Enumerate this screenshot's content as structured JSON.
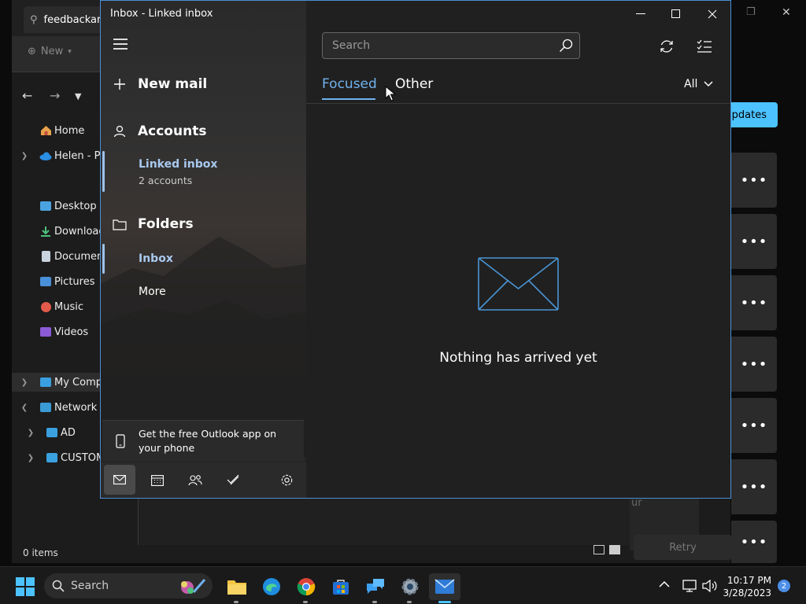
{
  "explorer": {
    "tab_title": "feedbackarc",
    "new_label": "New",
    "sidebar": [
      {
        "label": "Home"
      },
      {
        "label": "Helen - Per"
      },
      {
        "label": "Desktop"
      },
      {
        "label": "Downloads"
      },
      {
        "label": "Document"
      },
      {
        "label": "Pictures"
      },
      {
        "label": "Music"
      },
      {
        "label": "Videos"
      },
      {
        "label": "My Compu"
      },
      {
        "label": "Network"
      },
      {
        "label": "AD"
      },
      {
        "label": "CUSTOM"
      }
    ],
    "status": "0 items",
    "updates_label": "updates",
    "retry_label": "Retry",
    "partial_text": "ur",
    "more_glyph": "•••"
  },
  "mail": {
    "window_title": "Inbox - Linked inbox",
    "new_mail": "New mail",
    "accounts": "Accounts",
    "linked_inbox": "Linked inbox",
    "linked_inbox_sub": "2 accounts",
    "folders": "Folders",
    "inbox": "Inbox",
    "more": "More",
    "promo": "Get the free Outlook app on your phone",
    "search_placeholder": "Search",
    "tab_focused": "Focused",
    "tab_other": "Other",
    "filter": "All",
    "empty_message": "Nothing has arrived yet"
  },
  "taskbar": {
    "search_label": "Search",
    "time": "10:17 PM",
    "date": "3/28/2023",
    "notification_count": "2"
  },
  "colors": {
    "accent": "#4cc2ff",
    "mail_accent": "#6fb2ee",
    "window_border": "#4a8fd6"
  }
}
